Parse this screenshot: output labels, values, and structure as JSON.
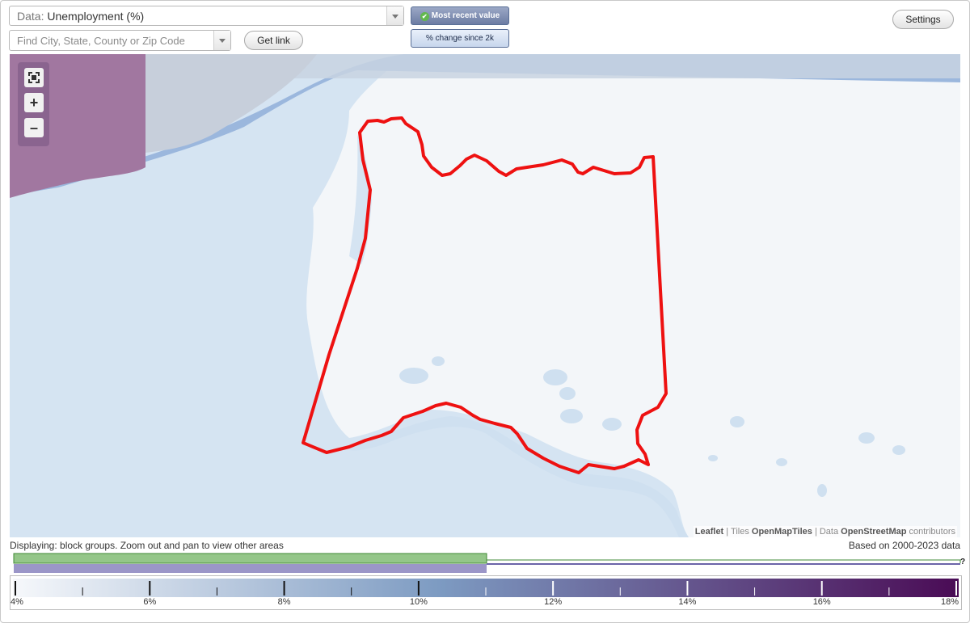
{
  "header": {
    "data_prefix": "Data:",
    "data_selected": "Unemployment (%)",
    "search_placeholder": "Find City, State, County or Zip Code",
    "get_link_label": "Get link",
    "settings_label": "Settings",
    "mode_recent_label": "Most recent value",
    "mode_change_label": "% change since 2k"
  },
  "map": {
    "boundary_color": "#ee1111",
    "water_color": "#d5e4f2",
    "land_color": "#f3f6f9",
    "shaded_region_color": "#a177a0",
    "attribution": {
      "leaflet": "Leaflet",
      "sep1": "| Tiles",
      "tiles": "OpenMapTiles",
      "sep2": "| Data",
      "osm": "OpenStreetMap",
      "contributors": "contributors"
    }
  },
  "status": {
    "displaying": "Displaying: block groups. Zoom out and pan to view other areas",
    "based_on": "Based on 2000-2023 data",
    "unknown_marker": "?"
  },
  "distribution": {
    "green_fraction": 0.5,
    "purple_fraction": 0.5
  },
  "legend": {
    "min": 4,
    "max": 18,
    "color_start": "#f6f8fb",
    "color_mid": "#7d9bc2",
    "color_end": "#4a0b55",
    "labels": [
      "4%",
      "6%",
      "8%",
      "10%",
      "12%",
      "14%",
      "16%",
      "18%"
    ]
  }
}
